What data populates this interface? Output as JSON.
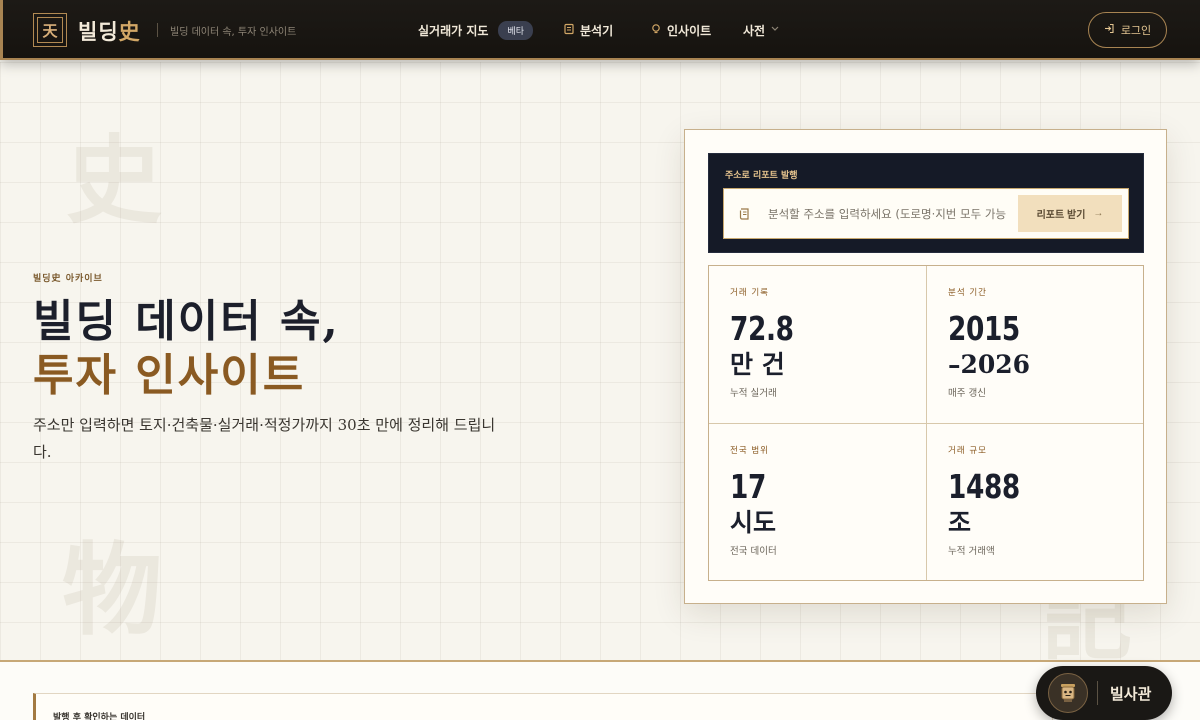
{
  "header": {
    "logo_glyph": "天",
    "brand_main": "빌딩",
    "brand_hanja": "史",
    "tagline": "빌딩 데이터 속, 투자 인사이트",
    "nav": {
      "map_label": "실거래가 지도",
      "beta_badge": "베타",
      "analyze_label": "분석기",
      "insight_label": "인사이트",
      "dict_label": "사전"
    },
    "login_label": "로그인"
  },
  "background": {
    "deco_1": "史",
    "deco_2": "物",
    "deco_3": "記"
  },
  "hero": {
    "eyebrow": "빌딩史 아카이브",
    "title_line1": "빌딩 데이터 속,",
    "title_line2": "투자 인사이트",
    "lead": "주소만 입력하면 토지·건축물·실거래·적정가까지 30초 만에 정리해 드립니다."
  },
  "report": {
    "label": "주소로 리포트 발행",
    "placeholder": "분석할 주소를 입력하세요 (도로명·지번 모두 가능)",
    "button_label": "리포트 받기"
  },
  "stats": [
    {
      "label": "거래 기록",
      "value": "72.8",
      "unit": "만 건",
      "sub": "누적 실거래"
    },
    {
      "label": "분석 기간",
      "value": "2015",
      "unit": "–2026",
      "sub": "매주 갱신"
    },
    {
      "label": "전국 범위",
      "value": "17",
      "unit": "시도",
      "sub": "전국 데이터"
    },
    {
      "label": "거래 규모",
      "value": "1488",
      "unit": "조",
      "sub": "누적 거래액"
    }
  ],
  "bottom": {
    "section_label": "발행 후 확인하는 데이터"
  },
  "chat": {
    "label": "빌사관"
  },
  "colors": {
    "accent_gold": "#a88452",
    "header_bg": "#1d1a16",
    "title_brown": "#8a5a22",
    "navy": "#151a27"
  }
}
